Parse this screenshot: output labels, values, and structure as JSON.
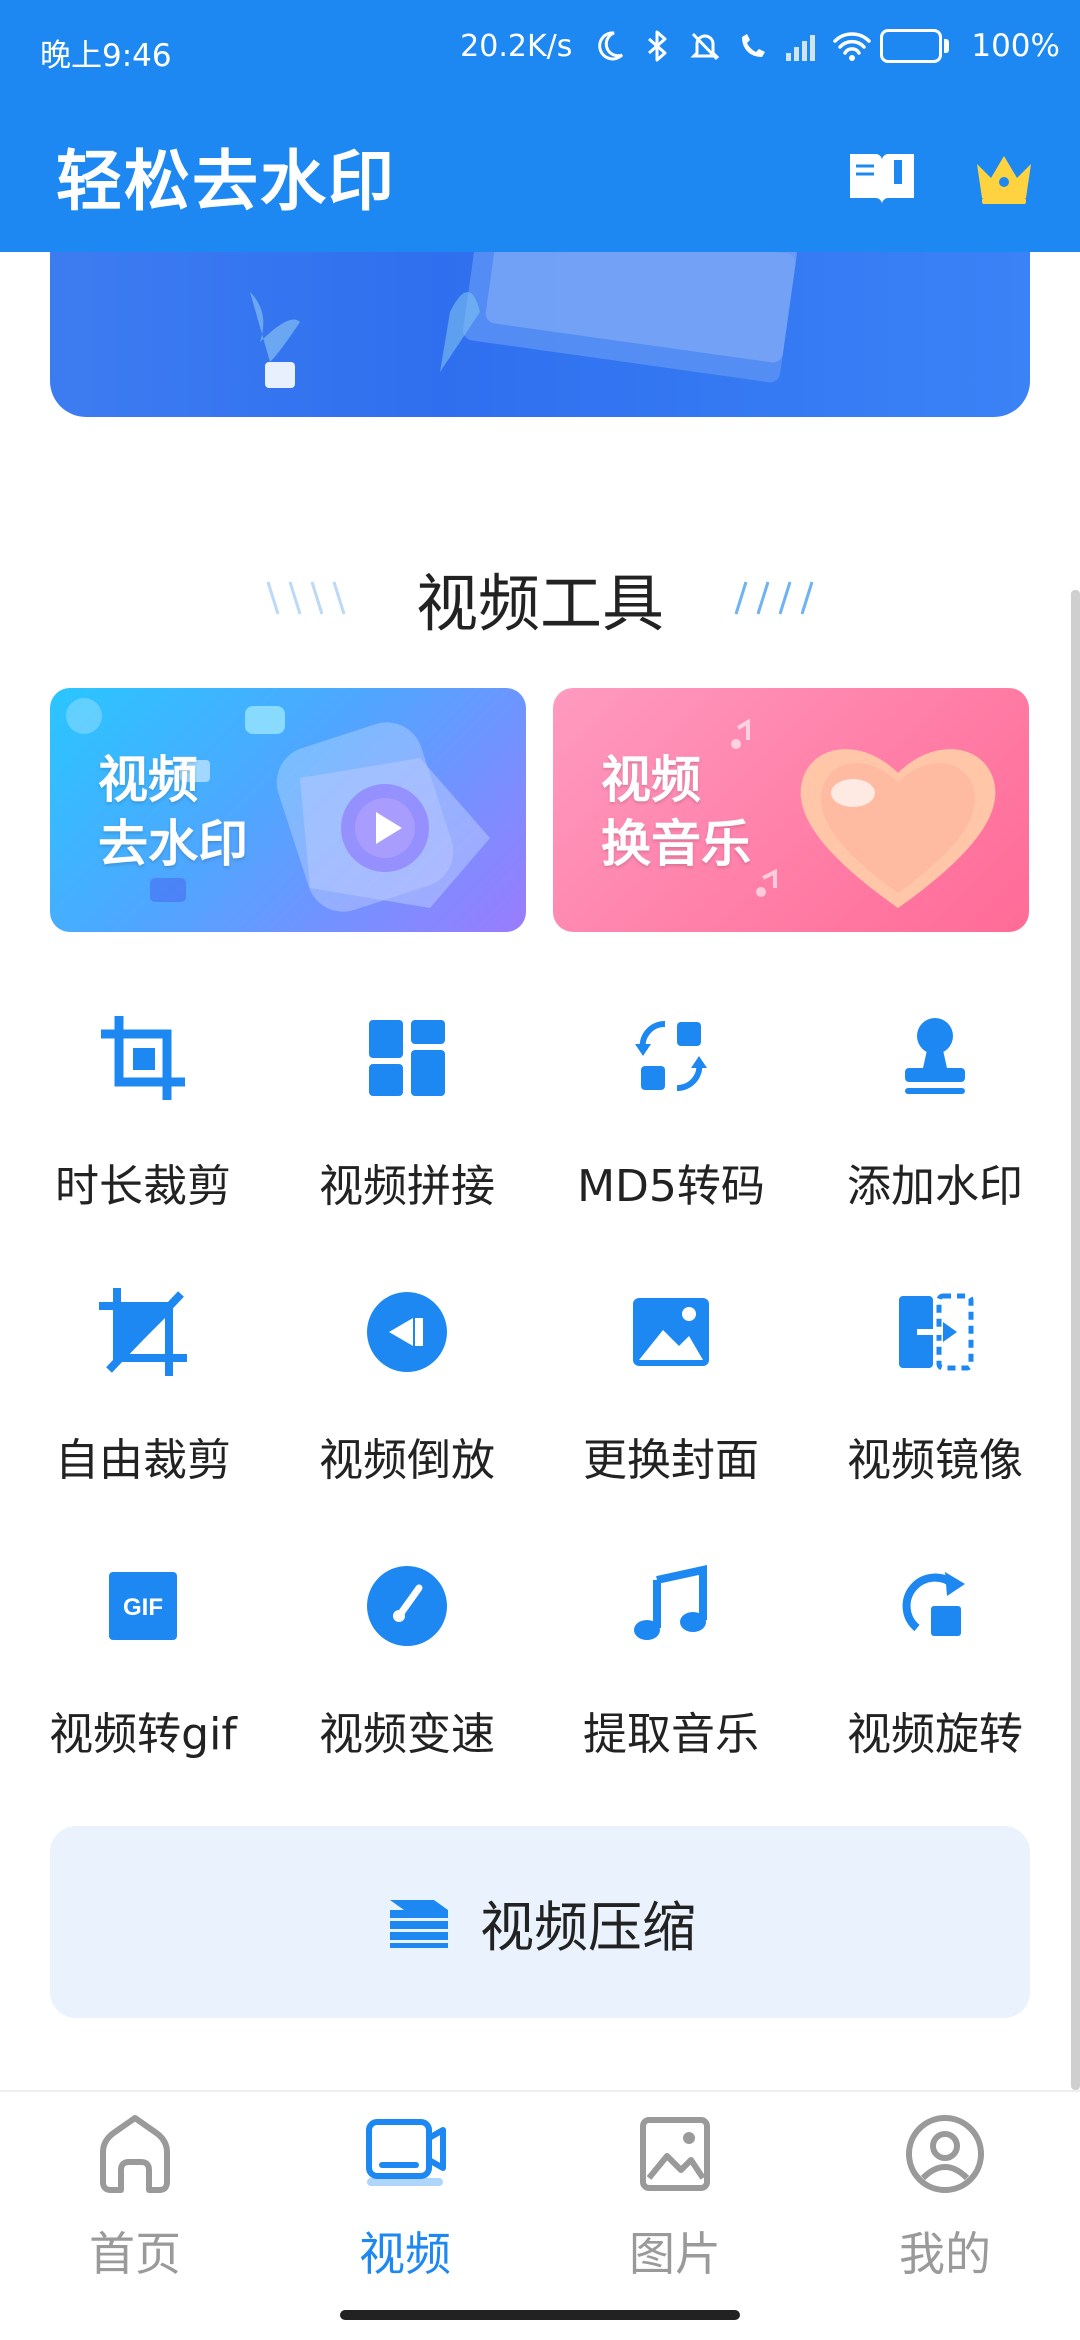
{
  "status_bar": {
    "time": "晚上9:46",
    "speed": "20.2K/s",
    "battery": "100%",
    "battery_level": 1.0
  },
  "app_bar": {
    "title": "轻松去水印",
    "icons": [
      "book-icon",
      "crown-icon"
    ]
  },
  "section": {
    "title": "视频工具"
  },
  "cards": [
    {
      "label_line1": "视频",
      "label_line2": "去水印",
      "icon": "video-play-icon"
    },
    {
      "label_line1": "视频",
      "label_line2": "换音乐",
      "icon": "heart-icon"
    }
  ],
  "tools": [
    {
      "label": "时长裁剪",
      "icon": "crop-icon"
    },
    {
      "label": "视频拼接",
      "icon": "grid-layout-icon"
    },
    {
      "label": "MD5转码",
      "icon": "convert-icon"
    },
    {
      "label": "添加水印",
      "icon": "stamp-icon"
    },
    {
      "label": "自由裁剪",
      "icon": "free-crop-icon"
    },
    {
      "label": "视频倒放",
      "icon": "rewind-icon"
    },
    {
      "label": "更换封面",
      "icon": "image-icon"
    },
    {
      "label": "视频镜像",
      "icon": "mirror-icon"
    },
    {
      "label": "视频转gif",
      "icon": "gif-icon"
    },
    {
      "label": "视频变速",
      "icon": "speed-dial-icon"
    },
    {
      "label": "提取音乐",
      "icon": "music-note-icon"
    },
    {
      "label": "视频旋转",
      "icon": "rotate-icon"
    }
  ],
  "compress": {
    "label": "视频压缩",
    "icon": "layers-icon"
  },
  "bottom_nav": [
    {
      "label": "首页",
      "icon": "home-icon",
      "active": false
    },
    {
      "label": "视频",
      "icon": "video-icon",
      "active": true
    },
    {
      "label": "图片",
      "icon": "picture-icon",
      "active": false
    },
    {
      "label": "我的",
      "icon": "profile-icon",
      "active": false
    }
  ],
  "colors": {
    "primary": "#1E88F2",
    "inactive": "#9a9a9a",
    "compress_bg": "#EAF3FD"
  }
}
